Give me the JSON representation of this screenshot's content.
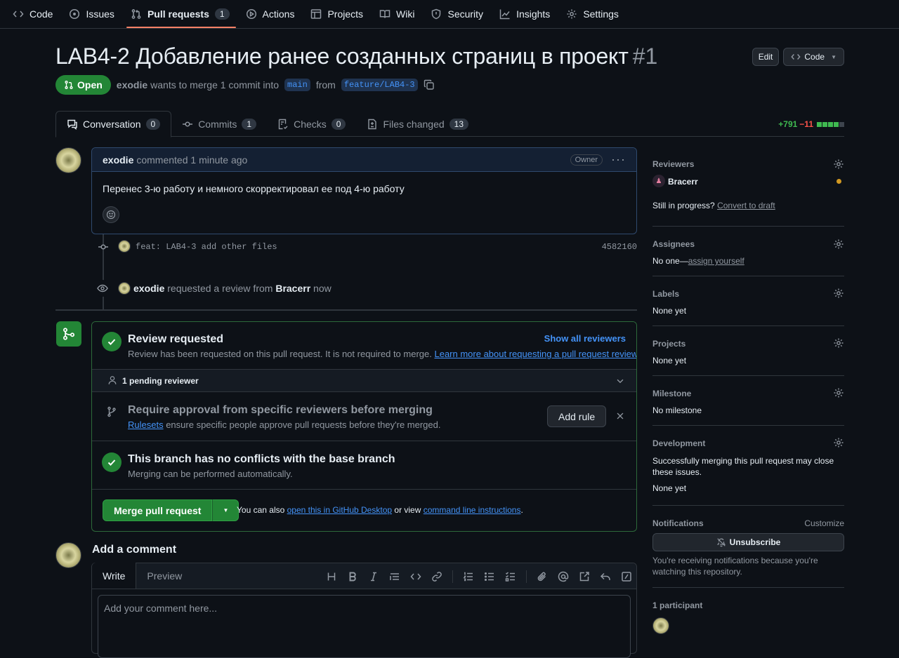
{
  "nav": {
    "items": [
      {
        "label": "Code",
        "icon": "code-icon"
      },
      {
        "label": "Issues",
        "icon": "issue-icon"
      },
      {
        "label": "Pull requests",
        "icon": "pull-request-icon",
        "count": "1"
      },
      {
        "label": "Actions",
        "icon": "play-icon"
      },
      {
        "label": "Projects",
        "icon": "table-icon"
      },
      {
        "label": "Wiki",
        "icon": "book-icon"
      },
      {
        "label": "Security",
        "icon": "shield-icon"
      },
      {
        "label": "Insights",
        "icon": "graph-icon"
      },
      {
        "label": "Settings",
        "icon": "gear-icon"
      }
    ]
  },
  "pr": {
    "title": "LAB4-2 Добавление ранее созданных страниц в проект",
    "number": "#1",
    "edit_label": "Edit",
    "code_label": "Code",
    "state": "Open",
    "author": "exodie",
    "merge_text_1": "wants to merge 1 commit into",
    "base": "main",
    "merge_text_2": "from",
    "head": "feature/LAB4-3"
  },
  "tabs": [
    {
      "label": "Conversation",
      "count": "0"
    },
    {
      "label": "Commits",
      "count": "1"
    },
    {
      "label": "Checks",
      "count": "0"
    },
    {
      "label": "Files changed",
      "count": "13"
    }
  ],
  "diffstat": {
    "additions": "+791",
    "deletions": "−11"
  },
  "comment": {
    "author": "exodie",
    "action": "commented 1 minute ago",
    "badge": "Owner",
    "body": "Перенес 3-ю работу и немного скорректировал ее под 4-ю работу"
  },
  "timeline": {
    "commit_msg": "feat: LAB4-3 add other files",
    "commit_sha": "4582160",
    "review_actor": "exodie",
    "review_text": "requested a review from",
    "review_target": "Bracerr",
    "review_time": "now"
  },
  "merge": {
    "review_title": "Review requested",
    "review_desc": "Review has been requested on this pull request. It is not required to merge.",
    "review_link": "Learn more about requesting a pull request review.",
    "show_all": "Show all reviewers",
    "pending": "1 pending reviewer",
    "approval_title": "Require approval from specific reviewers before merging",
    "rulesets_link": "Rulesets",
    "approval_desc": "ensure specific people approve pull requests before they're merged.",
    "add_rule": "Add rule",
    "conflict_title": "This branch has no conflicts with the base branch",
    "conflict_desc": "Merging can be performed automatically.",
    "merge_button": "Merge pull request",
    "also_text": "You can also",
    "desktop_link": "open this in GitHub Desktop",
    "or_view": "or view",
    "cli_link": "command line instructions",
    "period": "."
  },
  "add_comment": {
    "heading": "Add a comment",
    "write_tab": "Write",
    "preview_tab": "Preview",
    "placeholder": "Add your comment here..."
  },
  "sidebar": {
    "reviewers_h": "Reviewers",
    "reviewer_name": "Bracerr",
    "still_text": "Still in progress?",
    "convert_link": "Convert to draft",
    "assignees_h": "Assignees",
    "assignees_none": "No one—",
    "assign_link": "assign yourself",
    "labels_h": "Labels",
    "labels_val": "None yet",
    "projects_h": "Projects",
    "projects_val": "None yet",
    "milestone_h": "Milestone",
    "milestone_val": "No milestone",
    "development_h": "Development",
    "development_desc": "Successfully merging this pull request may close these issues.",
    "development_val": "None yet",
    "notifications_h": "Notifications",
    "customize": "Customize",
    "unsubscribe": "Unsubscribe",
    "notif_desc": "You're receiving notifications because you're watching this repository.",
    "participants_h": "1 participant"
  },
  "colors": {
    "green": "#238636",
    "accent": "#4493f8",
    "pending_dot": "#d29922",
    "danger": "#f85149",
    "success_text": "#3fb950"
  }
}
